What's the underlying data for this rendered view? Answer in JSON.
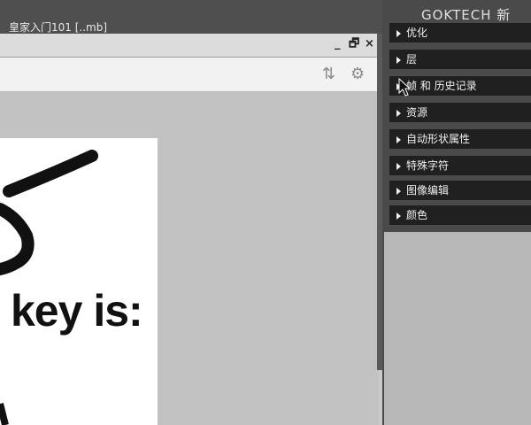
{
  "app": {
    "title": "皇家入门101 [..mb]"
  },
  "watermark": "GOKTECH 新",
  "doc_window": {
    "controls": {
      "minimize": "_",
      "restore": "🗗",
      "close": "×"
    }
  },
  "canvas": {
    "visible_text": "key is:"
  },
  "panels": [
    {
      "label": "优化"
    },
    {
      "label": "层"
    },
    {
      "label": "帧 和 历史记录"
    },
    {
      "label": "资源"
    },
    {
      "label": "自动形状属性"
    },
    {
      "label": "特殊字符"
    },
    {
      "label": "图像编辑"
    },
    {
      "label": "颜色"
    }
  ],
  "colors": {
    "panel_bar": "#202020",
    "dock_bg": "#4a4a4a",
    "canvas_bg": "#c2c2c2"
  }
}
